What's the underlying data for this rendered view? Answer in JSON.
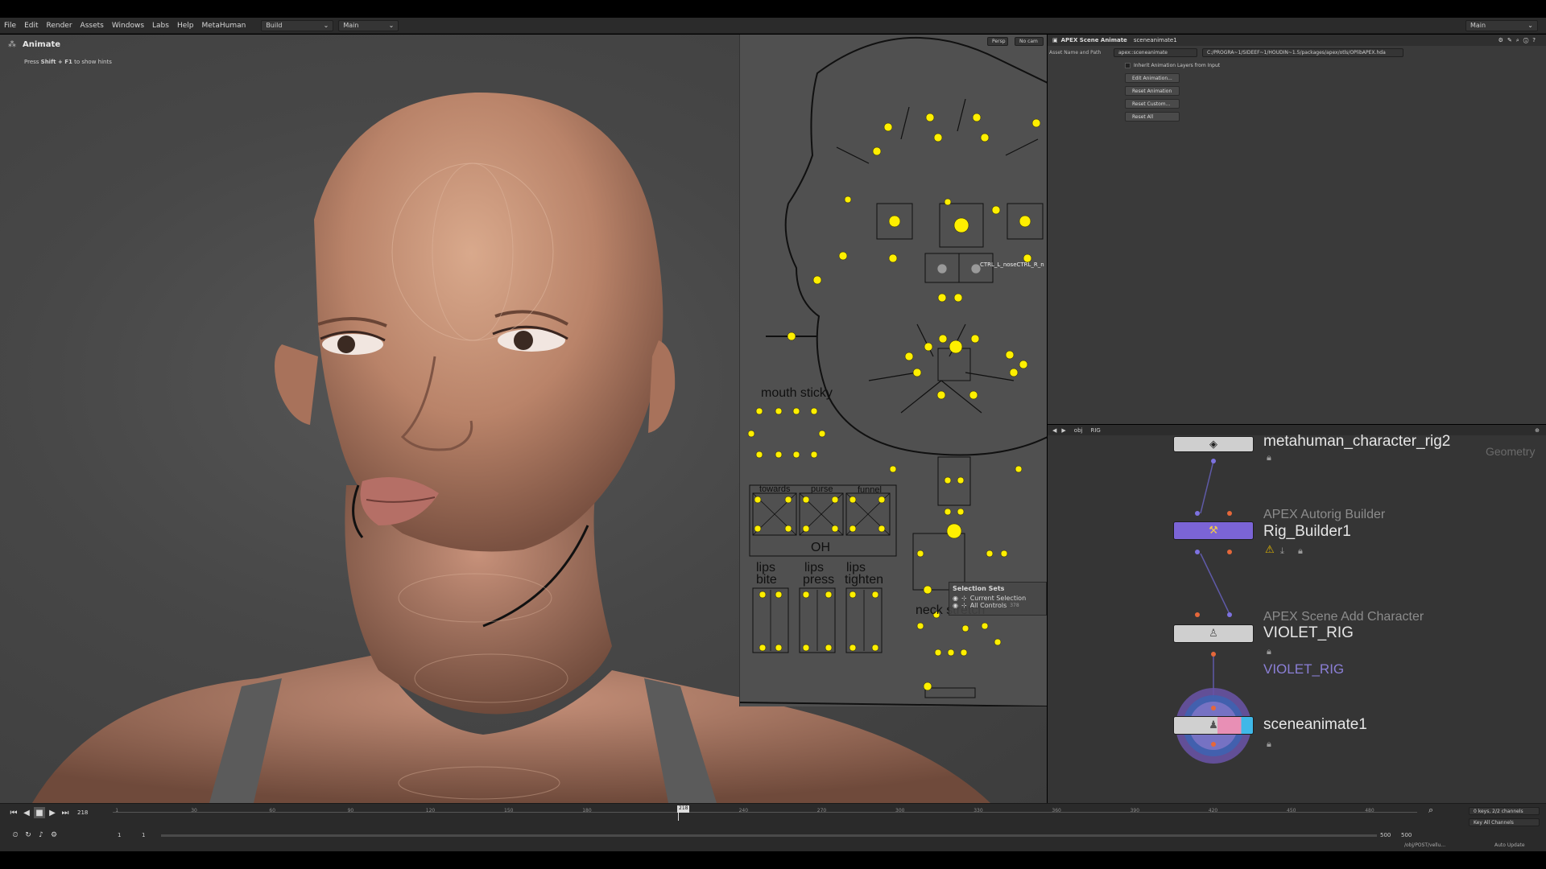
{
  "menu": {
    "items": [
      "File",
      "Edit",
      "Render",
      "Assets",
      "Windows",
      "Labs",
      "Help",
      "MetaHuman"
    ],
    "desktop": "Build",
    "context": "Main",
    "right_context": "Main"
  },
  "viewport": {
    "state_title": "Animate",
    "hint_prefix": "Press ",
    "hint_keys": "Shift + F1",
    "hint_suffix": " to show hints",
    "persp_label": "Persp",
    "cam_label": "No cam",
    "hover_label": "CTRL_L_noseCTRL_R_n"
  },
  "picker": {
    "labels": {
      "mouth_sticky": "mouth sticky",
      "towards": "towards",
      "purse": "purse",
      "funnel": "funnel",
      "oh": "OH",
      "lips_bite_1": "lips",
      "lips_bite_2": "bite",
      "lips_press_1": "lips",
      "lips_press_2": "press",
      "lips_tighten_1": "lips",
      "lips_tighten_2": "tighten",
      "neck_stretch": "neck stretch"
    },
    "control_color": "#ffef00"
  },
  "selection_sets": {
    "title": "Selection Sets",
    "current": "Current Selection",
    "all": "All Controls",
    "all_count": "378"
  },
  "params": {
    "node_type": "APEX Scene Animate",
    "node_name": "sceneanimate1",
    "asset_label": "Asset Name and Path",
    "asset_name": "apex::sceneanimate",
    "asset_path": "C:/PROGRA~1/SIDEEF~1/HOUDIN~1.5/packages/apex/otls/OPlibAPEX.hda",
    "inherit_label": "Inherit Animation Layers from Input",
    "buttons": [
      "Edit Animation...",
      "Reset Animation",
      "Reset Custom...",
      "Reset All"
    ]
  },
  "network": {
    "path_obj": "obj",
    "path_rig": "RIG",
    "context_label": "Geometry",
    "nodes": [
      {
        "type": "",
        "name": "metahuman_character_rig2"
      },
      {
        "type": "APEX Autorig Builder",
        "name": "Rig_Builder1"
      },
      {
        "type": "APEX Scene Add Character",
        "name": "VIOLET_RIG",
        "sub": "VIOLET_RIG"
      },
      {
        "type": "",
        "name": "sceneanimate1"
      }
    ],
    "colors": {
      "rig_builder": "#7b64d6",
      "violet": "#8b7fd6",
      "wire": "#6a64b8"
    }
  },
  "timeline": {
    "current_frame": "218",
    "start_a": "1",
    "start_b": "1",
    "end_a": "500",
    "end_b": "500",
    "ticks": [
      "1",
      "30",
      "60",
      "90",
      "120",
      "150",
      "180",
      "218",
      "240",
      "270",
      "300",
      "330",
      "360",
      "390",
      "420",
      "450",
      "480"
    ],
    "keys_info": "0 keys, 2/2 channels",
    "key_channels": "Key All Channels",
    "status_path": "/obj/POST/vellu...",
    "auto_update": "Auto Update"
  }
}
